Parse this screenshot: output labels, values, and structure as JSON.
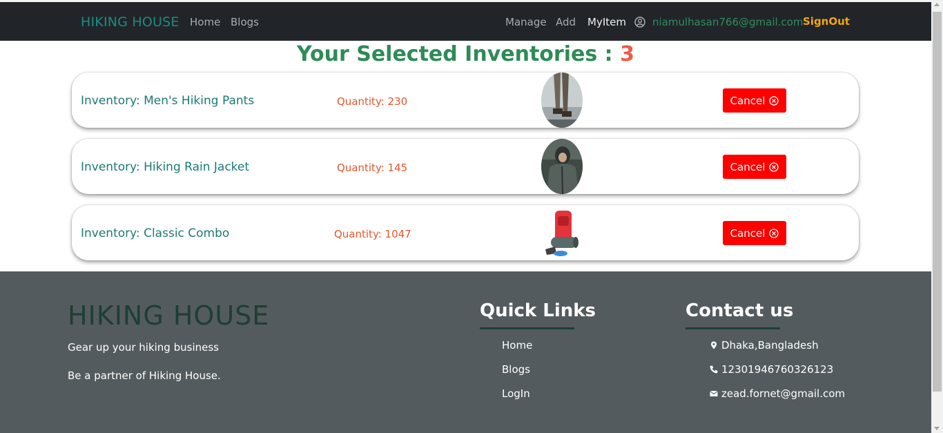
{
  "nav": {
    "brand": "HIKING HOUSE",
    "left_links": [
      "Home",
      "Blogs"
    ],
    "right_links": [
      "Manage",
      "Add",
      "MyItem"
    ],
    "user_email": "niamulhasan766@gmail.com",
    "signout_label": "SignOut",
    "active_link": "MyItem"
  },
  "heading": {
    "text": "Your Selected Inventories : ",
    "count": "3"
  },
  "inventories": [
    {
      "name": "Inventory: Men's Hiking Pants",
      "quantity": "Quantity: 230",
      "image_icon": "hiking-pants-image",
      "cancel_label": "Cancel"
    },
    {
      "name": "Inventory: Hiking Rain Jacket",
      "quantity": "Quantity: 145",
      "image_icon": "rain-jacket-image",
      "cancel_label": "Cancel"
    },
    {
      "name": "Inventory: Classic Combo",
      "quantity": "Quantity: 1047",
      "image_icon": "backpack-combo-image",
      "cancel_label": "Cancel"
    }
  ],
  "footer": {
    "brand": "HIKING HOUSE",
    "tagline1": "Gear up your hiking business",
    "tagline2": "Be a partner of Hiking House.",
    "quick_links_title": "Quick Links",
    "quick_links": [
      "Home",
      "Blogs",
      "LogIn"
    ],
    "contact_title": "Contact us",
    "contact": {
      "location": "Dhaka,Bangladesh",
      "phone": "12301946760326123",
      "email": "zead.fornet@gmail.com"
    }
  },
  "colors": {
    "navbar_bg": "#212529",
    "brand": "#1f8b83",
    "heading": "#2e8b57",
    "count": "#ef5a48",
    "cancel_bg": "#ff0000",
    "signout": "#f2a60f",
    "footer_bg": "#545b5e"
  }
}
